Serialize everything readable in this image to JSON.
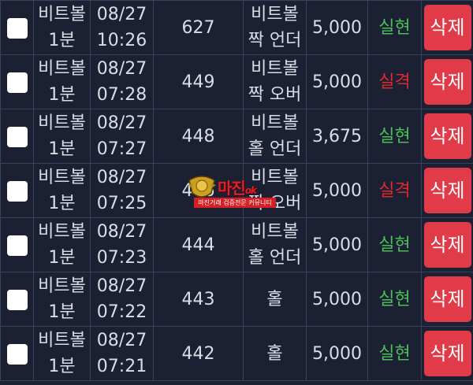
{
  "colors": {
    "background": "#1b2133",
    "border": "#39425a",
    "text": "#d9dde6",
    "win": "#4bbf56",
    "lose": "#e0282e",
    "delete_button": "#e13b4a"
  },
  "rows": [
    {
      "game_line1": "비트볼",
      "game_line2": "1분",
      "date": "08/27",
      "time": "10:26",
      "round": "627",
      "pick_line1": "비트볼",
      "pick_line2": "짝 언더",
      "amount": "5,000",
      "result": "실현",
      "outcome": "win",
      "delete_label": "삭제"
    },
    {
      "game_line1": "비트볼",
      "game_line2": "1분",
      "date": "08/27",
      "time": "07:28",
      "round": "449",
      "pick_line1": "비트볼",
      "pick_line2": "짝 오버",
      "amount": "5,000",
      "result": "실격",
      "outcome": "lose",
      "delete_label": "삭제"
    },
    {
      "game_line1": "비트볼",
      "game_line2": "1분",
      "date": "08/27",
      "time": "07:27",
      "round": "448",
      "pick_line1": "비트볼",
      "pick_line2": "홀 언더",
      "amount": "3,675",
      "result": "실현",
      "outcome": "win",
      "delete_label": "삭제"
    },
    {
      "game_line1": "비트볼",
      "game_line2": "1분",
      "date": "08/27",
      "time": "07:25",
      "round": "446",
      "pick_line1": "비트볼",
      "pick_line2": "짝 오버",
      "amount": "5,000",
      "result": "실격",
      "outcome": "lose",
      "delete_label": "삭제"
    },
    {
      "game_line1": "비트볼",
      "game_line2": "1분",
      "date": "08/27",
      "time": "07:23",
      "round": "444",
      "pick_line1": "비트볼",
      "pick_line2": "홀 언더",
      "amount": "5,000",
      "result": "실현",
      "outcome": "win",
      "delete_label": "삭제"
    },
    {
      "game_line1": "비트볼",
      "game_line2": "1분",
      "date": "08/27",
      "time": "07:22",
      "round": "443",
      "pick_line1": "",
      "pick_line2": "홀",
      "amount": "5,000",
      "result": "실현",
      "outcome": "win",
      "delete_label": "삭제"
    },
    {
      "game_line1": "비트볼",
      "game_line2": "1분",
      "date": "08/27",
      "time": "07:21",
      "round": "442",
      "pick_line1": "",
      "pick_line2": "홀",
      "amount": "5,000",
      "result": "실현",
      "outcome": "win",
      "delete_label": "삭제"
    }
  ],
  "watermark": {
    "title": "마진",
    "title_suffix": "ok",
    "subtitle": "마진거래 검증전문 커뮤니티"
  }
}
